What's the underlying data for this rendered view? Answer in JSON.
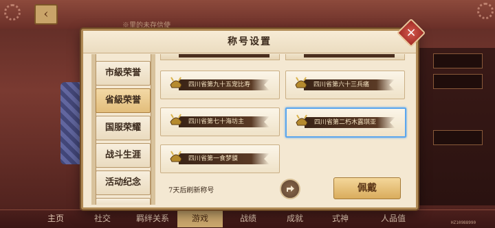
{
  "header": {
    "hint": "※里的未存信使"
  },
  "dialog": {
    "title": "称号设置",
    "close_label": "×"
  },
  "sidebar": {
    "items": [
      {
        "label": "市級荣誉",
        "active": false
      },
      {
        "label": "省級荣誉",
        "active": true
      },
      {
        "label": "国服荣耀",
        "active": false
      },
      {
        "label": "战斗生涯",
        "active": false
      },
      {
        "label": "活动纪念",
        "active": false
      }
    ]
  },
  "titles": [
    {
      "label": "四川省第九十五宠比寿",
      "selected": false
    },
    {
      "label": "四川省第六十三兵痛",
      "selected": false
    },
    {
      "label": "四川省第七十海坊主",
      "selected": false
    },
    {
      "label": "四川省第二朽木露琪亚",
      "selected": true
    },
    {
      "label": "四川省第一食梦貘",
      "selected": false
    }
  ],
  "footer": {
    "refresh_text": "7天后刷新称号",
    "wear_label": "佩戴"
  },
  "bottom_nav": [
    {
      "label": "主页"
    },
    {
      "label": "社交"
    },
    {
      "label": "羁绊关系"
    },
    {
      "label": "游戏"
    },
    {
      "label": "战绩"
    },
    {
      "label": "成就"
    },
    {
      "label": "式神"
    },
    {
      "label": "人品值"
    }
  ],
  "version": "HZ10988990",
  "colors": {
    "accent_gold": "#caa76d",
    "selected_border": "#5aa6ee",
    "close_red": "#c0392b"
  }
}
